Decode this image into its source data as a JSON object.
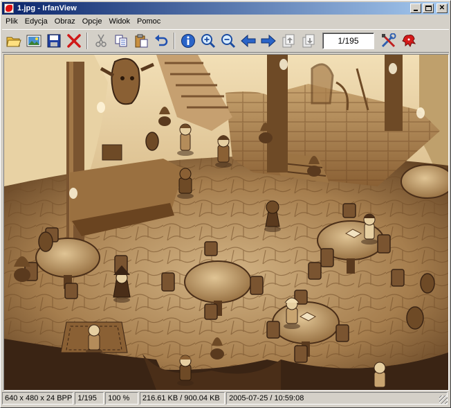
{
  "window": {
    "title": "1.jpg - IrfanView"
  },
  "menu": [
    {
      "label": "Plik"
    },
    {
      "label": "Edycja"
    },
    {
      "label": "Obraz"
    },
    {
      "label": "Opcje"
    },
    {
      "label": "Widok"
    },
    {
      "label": "Pomoc"
    }
  ],
  "toolbar": {
    "icons": [
      "open-folder-icon",
      "thumbnails-icon",
      "save-icon",
      "delete-icon",
      "cut-icon",
      "copy-icon",
      "paste-icon",
      "undo-icon",
      "info-icon",
      "zoom-in-icon",
      "zoom-out-icon",
      "previous-icon",
      "next-icon",
      "previous-page-icon",
      "next-page-icon",
      "settings-icon",
      "exit-icon"
    ],
    "page_value": "1/195"
  },
  "status": {
    "dimensions": "640 x 480 x 24 BPP",
    "index": "1/195",
    "zoom": "100 %",
    "size": "216.61 KB / 900.04 KB",
    "datetime": "2005-07-25 / 10:59:08"
  },
  "colors": {
    "title_start": "#0a246a",
    "title_end": "#a6caf0",
    "face": "#d4d0c8",
    "canvas_bg": "#402818",
    "sepia_light": "#e6cfa1",
    "sepia_mid": "#b48c5a",
    "sepia_dark": "#5a3a1e"
  }
}
